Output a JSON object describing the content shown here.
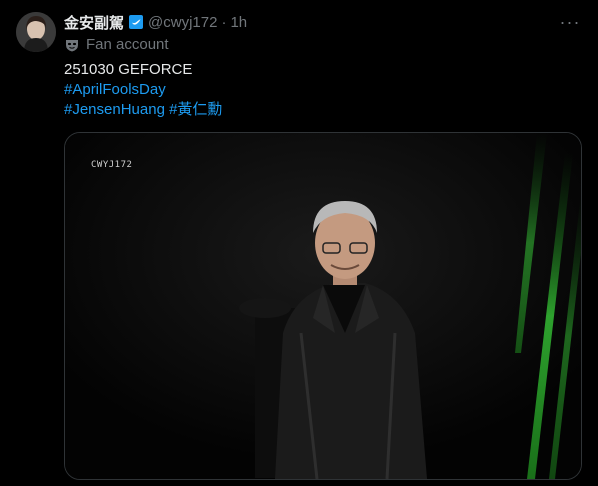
{
  "author": {
    "display_name": "金安副駕",
    "handle": "@cwyj172",
    "separator": "·",
    "timestamp": "1h"
  },
  "affiliation": {
    "label": "Fan account",
    "icon": "mask-icon"
  },
  "tweet": {
    "line1": "251030 GEFORCE",
    "hashtag1": "#AprilFoolsDay",
    "hashtag2": "#JensenHuang",
    "hashtag3": "#黃仁勳"
  },
  "media": {
    "watermark": "CWYJ172"
  },
  "menu": {
    "icon": "more-icon",
    "label": "···"
  },
  "colors": {
    "background": "#000000",
    "accent": "#1d9bf0",
    "muted": "#71767b",
    "text": "#e7e9ea"
  }
}
